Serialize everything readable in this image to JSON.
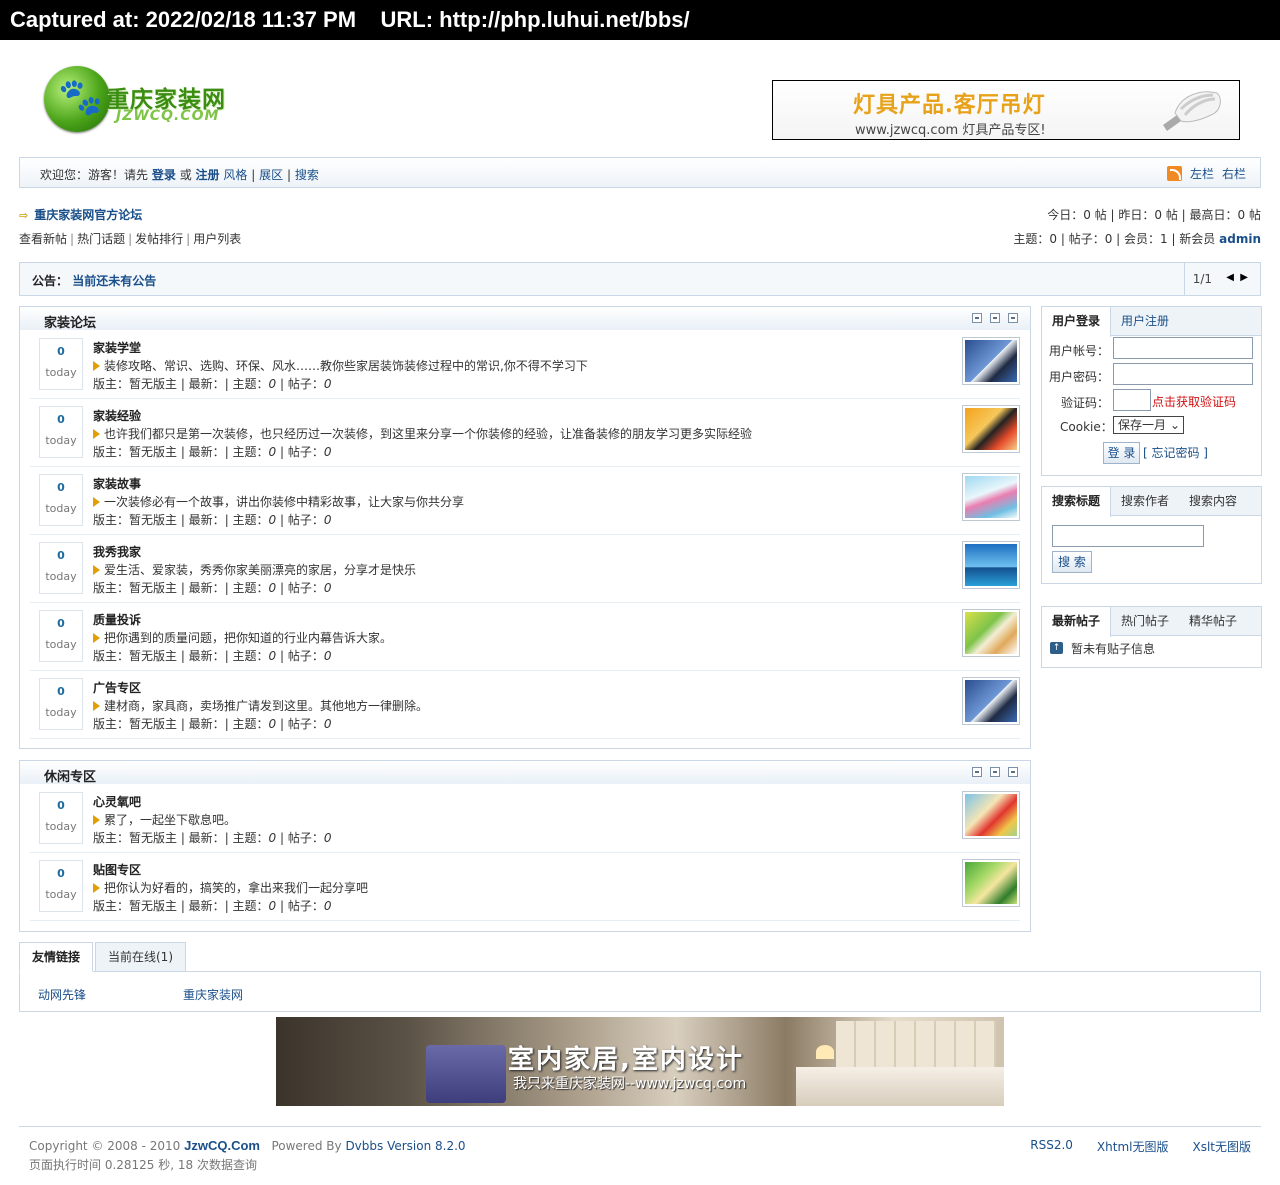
{
  "capture": {
    "text": "Captured at: 2022/02/18 11:37 PM    URL: http://php.luhui.net/bbs/"
  },
  "logo": {
    "cn": "重庆家装网",
    "en": "JZWCQ.COM"
  },
  "top_ad": {
    "title": "灯具产品.客厅吊灯",
    "sub": "www.jzwcq.com 灯具产品专区!"
  },
  "topnav": {
    "welcome": "欢迎您：游客！请先",
    "login": "登录",
    "or": "或",
    "register": "注册",
    "style": "风格",
    "expand": "展区",
    "search": "搜索",
    "left_col": "左栏",
    "right_col": "右栏",
    "sep": "|"
  },
  "forum": {
    "title": "重庆家装网官方论坛",
    "stats_today": "今日：0 帖 | 昨日：0 帖 | 最高日：0 帖",
    "links": [
      "查看新帖",
      "热门话题",
      "发帖排行",
      "用户列表"
    ],
    "stats_totals": "主题：0 | 帖子：0 | 会员：1 | 新会员",
    "newest_member": "admin"
  },
  "announcement": {
    "label": "公告：",
    "text": "当前还未有公告",
    "page": "1/1"
  },
  "categories": [
    {
      "title": "家装论坛",
      "boards": [
        {
          "count": "0",
          "date": "today",
          "name": "家装学堂",
          "desc": "装修攻略、常识、选购、环保、风水……教你些家居装饰装修过程中的常识,你不得不学习下",
          "meta_a": "版主：暂无版主 | 最新：",
          "meta_b": "| 主题：",
          "topics": "0",
          "meta_c": "| 帖子：",
          "posts": "0"
        },
        {
          "count": "0",
          "date": "today",
          "name": "家装经验",
          "desc": "也许我们都只是第一次装修，也只经历过一次装修，到这里来分享一个你装修的经验，让准备装修的朋友学习更多实际经验",
          "meta_a": "版主：暂无版主 | 最新：",
          "meta_b": "| 主题：",
          "topics": "0",
          "meta_c": "| 帖子：",
          "posts": "0"
        },
        {
          "count": "0",
          "date": "today",
          "name": "家装故事",
          "desc": "一次装修必有一个故事，讲出你装修中精彩故事，让大家与你共分享",
          "meta_a": "版主：暂无版主 | 最新：",
          "meta_b": "| 主题：",
          "topics": "0",
          "meta_c": "| 帖子：",
          "posts": "0"
        },
        {
          "count": "0",
          "date": "today",
          "name": "我秀我家",
          "desc": "爱生活、爱家装，秀秀你家美丽漂亮的家居，分享才是快乐",
          "meta_a": "版主：暂无版主 | 最新：",
          "meta_b": "| 主题：",
          "topics": "0",
          "meta_c": "| 帖子：",
          "posts": "0"
        },
        {
          "count": "0",
          "date": "today",
          "name": "质量投诉",
          "desc": "把你遇到的质量问题，把你知道的行业内幕告诉大家。",
          "meta_a": "版主：暂无版主 | 最新：",
          "meta_b": "| 主题：",
          "topics": "0",
          "meta_c": "| 帖子：",
          "posts": "0"
        },
        {
          "count": "0",
          "date": "today",
          "name": "广告专区",
          "desc": "建材商，家具商，卖场推广请发到这里。其他地方一律删除。",
          "meta_a": "版主：暂无版主 | 最新：",
          "meta_b": "| 主题：",
          "topics": "0",
          "meta_c": "| 帖子：",
          "posts": "0"
        }
      ]
    },
    {
      "title": "休闲专区",
      "boards": [
        {
          "count": "0",
          "date": "today",
          "name": "心灵氧吧",
          "desc": "累了，一起坐下歇息吧。",
          "meta_a": "版主：暂无版主 | 最新：",
          "meta_b": "| 主题：",
          "topics": "0",
          "meta_c": "| 帖子：",
          "posts": "0"
        },
        {
          "count": "0",
          "date": "today",
          "name": "贴图专区",
          "desc": "把你认为好看的，搞笑的，拿出来我们一起分享吧",
          "meta_a": "版主：暂无版主 | 最新：",
          "meta_b": "| 主题：",
          "topics": "0",
          "meta_c": "| 帖子：",
          "posts": "0"
        }
      ]
    }
  ],
  "login_panel": {
    "tab_login": "用户登录",
    "tab_register": "用户注册",
    "username_label": "用户帐号：",
    "password_label": "用户密码：",
    "captcha_label": "验证码：",
    "captcha_link": "点击获取验证码",
    "cookie_label": "Cookie：",
    "cookie_value": "保存一月",
    "login_button": "登 录",
    "forgot": "[ 忘记密码 ]"
  },
  "search_panel": {
    "tabs": [
      "搜索标题",
      "搜索作者",
      "搜索内容"
    ],
    "button": "搜 索"
  },
  "posts_panel": {
    "tabs": [
      "最新帖子",
      "热门帖子",
      "精华帖子"
    ],
    "empty": "暂未有贴子信息"
  },
  "friend_links": {
    "tab_links": "友情链接",
    "tab_online": "当前在线(1)",
    "links": [
      "动网先锋",
      "重庆家装网"
    ]
  },
  "bottom_ad": {
    "title": "室内家居,室内设计",
    "sub": "我只来重庆家装网--www.jzwcq.com"
  },
  "footer": {
    "copyright": "Copyright © 2008 - 2010",
    "site": "JzwCQ.Com",
    "powered": "Powered By",
    "version": "Dvbbs Version 8.2.0",
    "exec": "页面执行时间 0.28125 秒, 18 次数据查询",
    "links": [
      "RSS2.0",
      "Xhtml无图版",
      "Xslt无图版"
    ]
  },
  "colors": {
    "link": "#1a4f8a",
    "border": "#c9d7e6",
    "accent": "#e1a000",
    "alert": "#d01010"
  }
}
